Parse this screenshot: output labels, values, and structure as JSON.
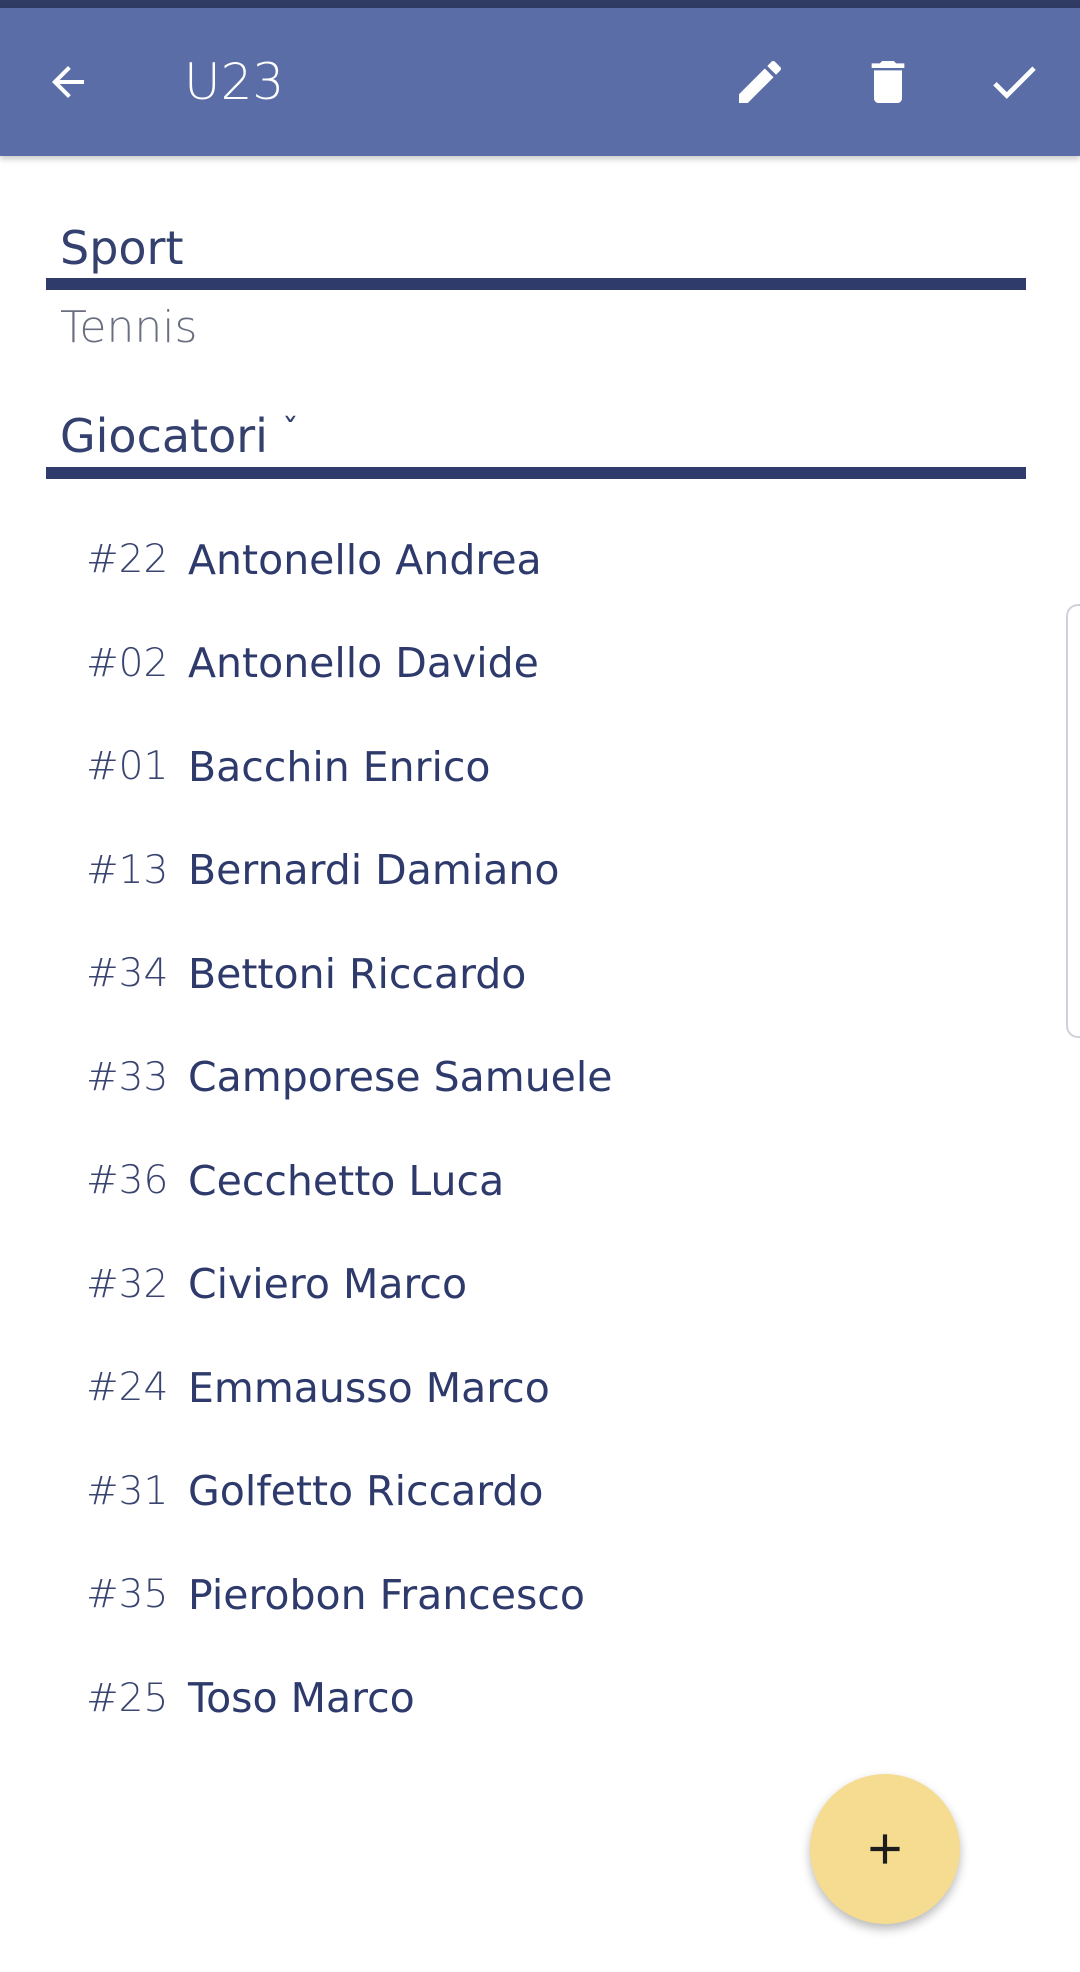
{
  "app_bar": {
    "title": "U23",
    "icons": {
      "back": "arrow-back-icon",
      "edit": "pencil-icon",
      "delete": "trash-icon",
      "confirm": "check-icon"
    },
    "background_color": "#5b6da6"
  },
  "sport": {
    "label": "Sport",
    "value": "Tennis"
  },
  "players": {
    "label": "Giocatori",
    "chevron": "ˇ",
    "items": [
      {
        "number": "#22",
        "name": "Antonello Andrea"
      },
      {
        "number": "#02",
        "name": "Antonello Davide"
      },
      {
        "number": "#01",
        "name": "Bacchin Enrico"
      },
      {
        "number": "#13",
        "name": "Bernardi Damiano"
      },
      {
        "number": "#34",
        "name": "Bettoni Riccardo"
      },
      {
        "number": "#33",
        "name": "Camporese Samuele"
      },
      {
        "number": "#36",
        "name": "Cecchetto Luca"
      },
      {
        "number": "#32",
        "name": "Civiero Marco"
      },
      {
        "number": "#24",
        "name": "Emmausso Marco"
      },
      {
        "number": "#31",
        "name": "Golfetto Riccardo"
      },
      {
        "number": "#35",
        "name": "Pierobon Francesco"
      },
      {
        "number": "#25",
        "name": "Toso Marco"
      }
    ]
  },
  "fab": {
    "icon": "plus-icon",
    "color": "#f5dc90"
  }
}
